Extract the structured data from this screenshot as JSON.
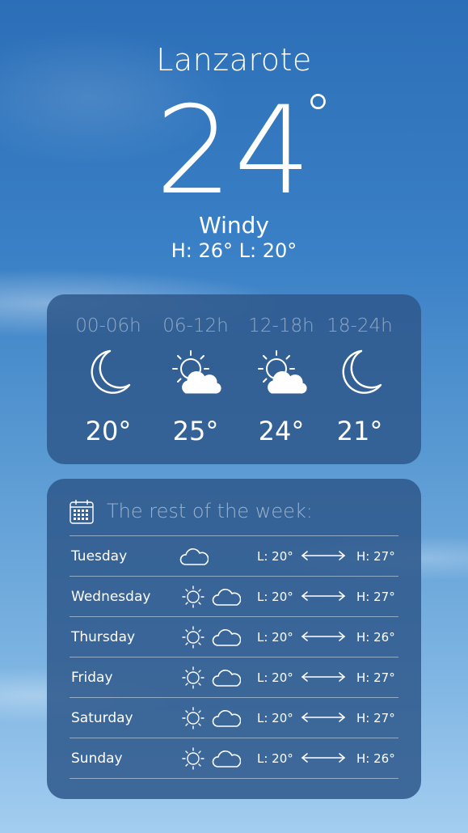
{
  "current": {
    "city": "Lanzarote",
    "temperature": "24",
    "degree_symbol": "°",
    "condition": "Windy",
    "high_low": "H: 26° L: 20°"
  },
  "today": [
    {
      "time": "00-06h",
      "icon": "moon-icon",
      "temp": "20°"
    },
    {
      "time": "06-12h",
      "icon": "sun-cloud-icon",
      "temp": "25°"
    },
    {
      "time": "12-18h",
      "icon": "sun-cloud-icon",
      "temp": "24°"
    },
    {
      "time": "18-24h",
      "icon": "moon-icon",
      "temp": "21°"
    }
  ],
  "week": {
    "title": "The rest of the week:",
    "title_icon": "calendar-icon",
    "days": [
      {
        "day": "Tuesday",
        "icons": [
          "cloud-icon"
        ],
        "low": "L: 20°",
        "high": "H: 27°"
      },
      {
        "day": "Wednesday",
        "icons": [
          "sun-icon",
          "cloud-icon"
        ],
        "low": "L: 20°",
        "high": "H: 27°"
      },
      {
        "day": "Thursday",
        "icons": [
          "sun-icon",
          "cloud-icon"
        ],
        "low": "L: 20°",
        "high": "H: 26°"
      },
      {
        "day": "Friday",
        "icons": [
          "sun-icon",
          "cloud-icon"
        ],
        "low": "L: 20°",
        "high": "H: 27°"
      },
      {
        "day": "Saturday",
        "icons": [
          "sun-icon",
          "cloud-icon"
        ],
        "low": "L: 20°",
        "high": "H: 27°"
      },
      {
        "day": "Sunday",
        "icons": [
          "sun-icon",
          "cloud-icon"
        ],
        "low": "L: 20°",
        "high": "H: 26°"
      }
    ]
  },
  "colors": {
    "sky_top": "#2c6fb8",
    "sky_bottom": "#a3cdf0",
    "card": "#2e588c",
    "text": "#ffffff"
  }
}
